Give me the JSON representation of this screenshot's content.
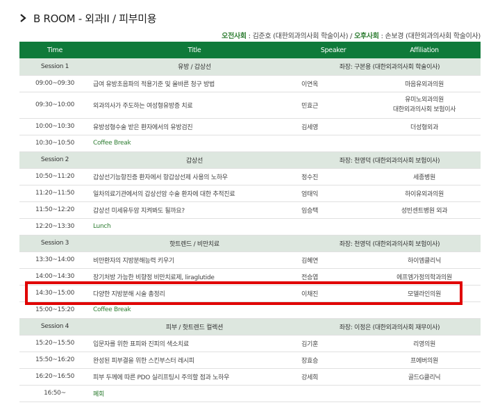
{
  "room_title": "B ROOM - 외과II / 피부미용",
  "chairs": {
    "am_label": "오전사회",
    "am_value": " : 김준호 (대한외과의사회 학술이사) / ",
    "pm_label": "오후사회",
    "pm_value": " : 손보경 (대한외과의사회 학술이사)"
  },
  "table": {
    "headers": {
      "time": "Time",
      "title": "Title",
      "speaker": "Speaker",
      "affiliation": "Affiliation"
    },
    "s1": {
      "session": {
        "label": "Session 1",
        "title": "유방 / 갑상선",
        "chair": "좌장: 구본용 (대한외과의사회 학술이사)"
      },
      "r1": {
        "time": "09:00~09:30",
        "title": "급여 유방초음파의 적용기준 및 올바른 청구 방법",
        "speaker": "이연옥",
        "aff": "마음유외과의원"
      },
      "r2": {
        "time": "09:30~10:00",
        "title": "외과의사가 주도하는 여성형유방증 치료",
        "speaker": "민효근",
        "aff1": "유미노외과의원",
        "aff2": "대한외과의사회 보험이사"
      },
      "r3": {
        "time": "10:00~10:30",
        "title": "유방성형수술 받은 환자에서의 유방검진",
        "speaker": "김세영",
        "aff": "더성형외과"
      },
      "r4": {
        "time": "10:30~10:50",
        "title": "Coffee Break"
      }
    },
    "s2": {
      "session": {
        "label": "Session 2",
        "title": "갑상선",
        "chair": "좌장: 천영덕 (대한외과의사회 보험이사)"
      },
      "r1": {
        "time": "10:50~11:20",
        "title": "갑상선기능항진증 환자에서 항갑상선제 사용의 노하우",
        "speaker": "정수진",
        "aff": "세종병원"
      },
      "r2": {
        "time": "11:20~11:50",
        "title": "일차의료기관에서의 갑상선암 수술 환자에 대한 추적진료",
        "speaker": "엄태익",
        "aff": "하이유외과의원"
      },
      "r3": {
        "time": "11:50~12:20",
        "title": "갑상선 미세유두암 지켜봐도 될까요?",
        "speaker": "임승택",
        "aff": "성빈센트병원 외과"
      },
      "r4": {
        "time": "12:20~13:30",
        "title": "Lunch"
      }
    },
    "s3": {
      "session": {
        "label": "Session 3",
        "title": "핫트렌드 / 비만치료",
        "chair": "좌장: 천영덕 (대한외과의사회 보험이사)"
      },
      "r1": {
        "time": "13:30~14:00",
        "title": "비만환자의 지방분해능력 키우기",
        "speaker": "김혜연",
        "aff": "하이엠클리닉"
      },
      "r2": {
        "time": "14:00~14:30",
        "title": "장기처방 가능한 비향정 비만치료제, liraglutide",
        "speaker": "전승엽",
        "aff": "에프엠가정의학과의원"
      },
      "r3": {
        "time": "14:30~15:00",
        "title": "다양한 지방분해 시술 총정리",
        "speaker": "이채진",
        "aff": "모델라인의원"
      },
      "r4": {
        "time": "15:00~15:20",
        "title": "Coffee Break"
      }
    },
    "s4": {
      "session": {
        "label": "Session 4",
        "title": "피부 / 핫트렌드 컬렉션",
        "chair": "좌장: 이정은 (대한외과의사회 재무이사)"
      },
      "r1": {
        "time": "15:20~15:50",
        "title": "입문자를 위한 표피와 진피의 색소치료",
        "speaker": "김기훈",
        "aff": "리영의원"
      },
      "r2": {
        "time": "15:50~16:20",
        "title": "완성된 피부결을 위한 스킨부스터 레시피",
        "speaker": "장효승",
        "aff": "프에버의원"
      },
      "r3": {
        "time": "16:20~16:50",
        "title": "피부 두께에 따른 PDO 실리프팅시 주의할 점과 노하우",
        "speaker": "강세희",
        "aff": "골드G클리닉"
      },
      "r4": {
        "time": "16:50~",
        "title": "폐회"
      }
    }
  },
  "colors": {
    "header_green": "#0f7a3a",
    "session_bg": "#dde7df",
    "highlight_red": "#e00000",
    "break_text": "#2e7d32"
  },
  "icons": {
    "title_marker": "chevron-right-icon"
  }
}
